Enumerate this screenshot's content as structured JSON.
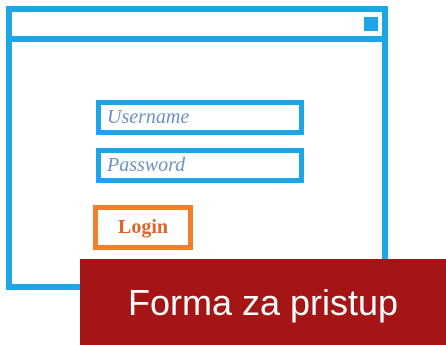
{
  "login_form": {
    "username_placeholder": "Username",
    "password_placeholder": "Password",
    "login_label": "Login"
  },
  "caption": {
    "text": "Forma za pristup"
  },
  "colors": {
    "window_border": "#1ea7e6",
    "login_border": "#f47e29",
    "caption_bg": "#a51515"
  }
}
